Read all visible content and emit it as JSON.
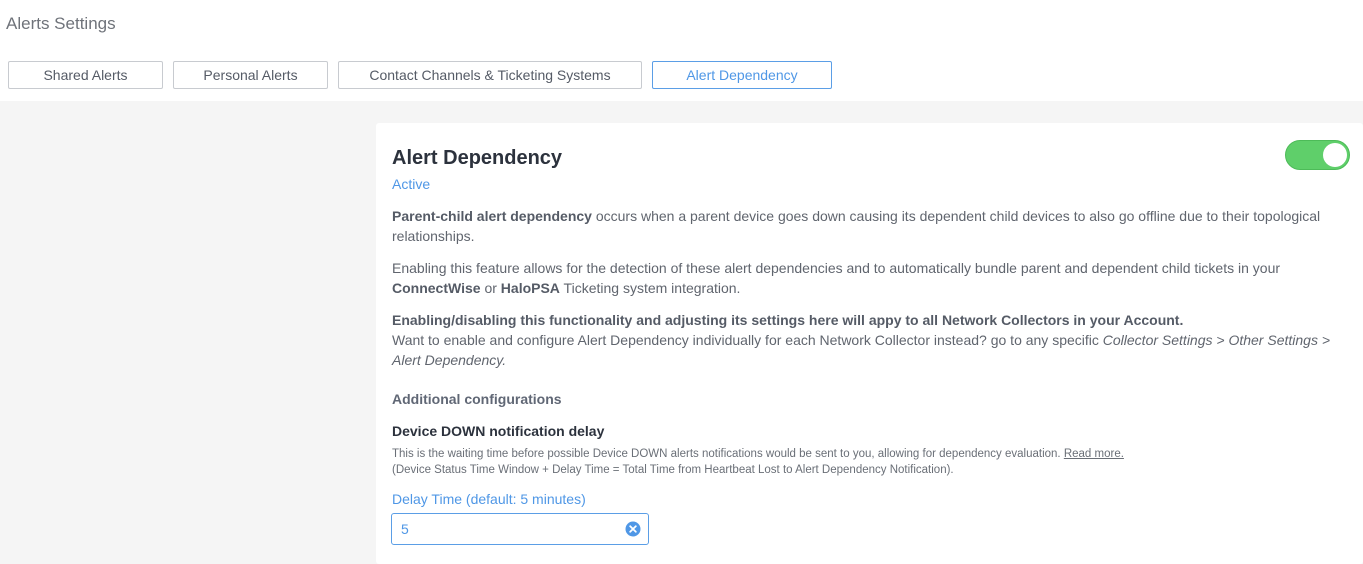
{
  "page": {
    "title": "Alerts Settings"
  },
  "tabs": [
    {
      "label": "Shared Alerts"
    },
    {
      "label": "Personal Alerts"
    },
    {
      "label": "Contact Channels & Ticketing Systems"
    },
    {
      "label": "Alert Dependency",
      "active": true
    }
  ],
  "card": {
    "title": "Alert Dependency",
    "status": "Active",
    "toggle_on": true,
    "p1": {
      "bold": "Parent-child alert dependency",
      "text": " occurs when a parent device goes down causing its dependent child devices to also go offline due to their topological relationships."
    },
    "p2": {
      "text_a": "Enabling this feature allows for the detection of these alert dependencies and to automatically bundle parent and dependent child tickets in your ",
      "bold_a": "ConnectWise",
      "text_b": " or ",
      "bold_b": "HaloPSA",
      "text_c": " Ticketing system integration."
    },
    "p3": {
      "bold": "Enabling/disabling this functionality and adjusting its settings here will appy to all Network Collectors in your Account.",
      "text": "Want to enable and configure Alert Dependency individually for each Network Collector instead? go to any specific ",
      "italic": "Collector Settings > Other Settings > Alert Dependency."
    },
    "additional_heading": "Additional configurations",
    "field_heading": "Device DOWN notification delay",
    "help_line1": "This is the waiting time before possible Device DOWN alerts notifications would be sent to you, allowing for dependency evaluation. ",
    "help_link": "Read more.",
    "help_line2": "(Device Status Time Window + Delay Time = Total Time from Heartbeat Lost to Alert Dependency Notification).",
    "delay_label": "Delay Time (default: 5 minutes)",
    "delay_value": "5"
  },
  "colors": {
    "accent": "#4f97e6",
    "toggle_on": "#5fcf6a",
    "background": "#f5f5f5"
  },
  "icons": [
    "clear-circle-icon"
  ]
}
